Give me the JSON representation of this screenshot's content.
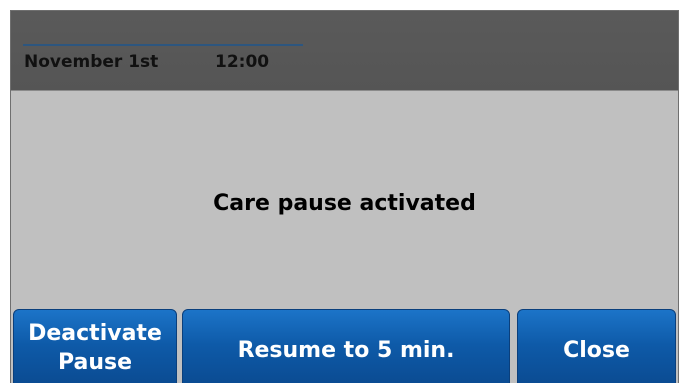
{
  "header": {
    "date": "November 1st",
    "time": "12:00"
  },
  "main": {
    "message": "Care pause activated"
  },
  "buttons": {
    "deactivate_line1": "Deactivate",
    "deactivate_line2": "Pause",
    "resume": "Resume to 5 min.",
    "close": "Close"
  },
  "colors": {
    "header_bg": "#555555",
    "body_bg": "#c0c0c0",
    "button_bg": "#0e5aa8",
    "accent_line": "#2d567f"
  }
}
